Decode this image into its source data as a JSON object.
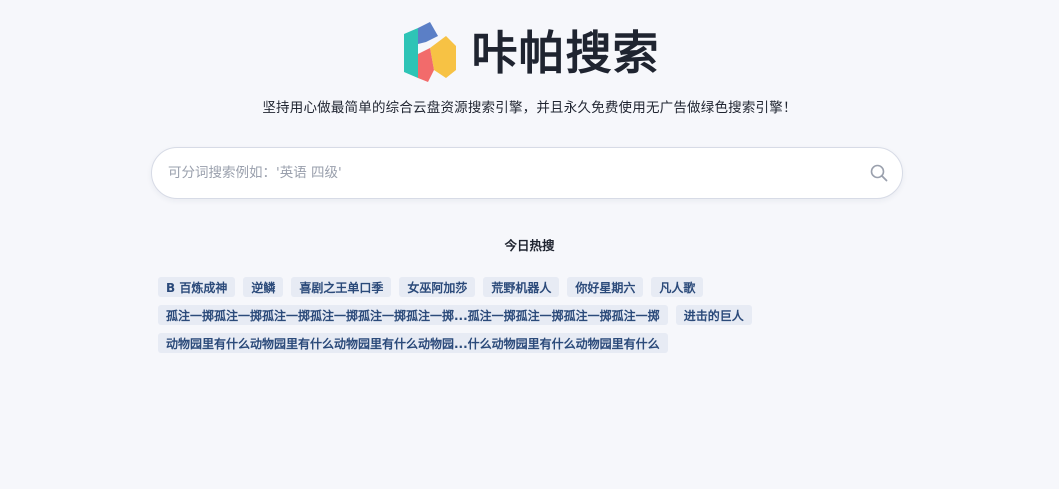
{
  "brand": {
    "title": "咔帕搜索",
    "logo_colors": {
      "teal": "#2ec4b6",
      "blue": "#5b7fc6",
      "red": "#f26b6b",
      "yellow": "#f7c244"
    }
  },
  "tagline": "坚持用心做最简单的综合云盘资源搜索引擎，并且永久免费使用无广告做绿色搜索引擎！",
  "search": {
    "value": "",
    "placeholder": "可分词搜索例如：'英语 四级'",
    "icon": "search-icon"
  },
  "hot": {
    "title": "今日热搜",
    "rows": [
      [
        "B 百炼成神",
        "逆鳞",
        "喜剧之王单口季",
        "女巫阿加莎",
        "荒野机器人",
        "你好星期六",
        "凡人歌"
      ],
      [
        "孤注一掷孤注一掷孤注一掷孤注一掷孤注一掷孤注一掷...孤注一掷孤注一掷孤注一掷孤注一掷",
        "进击的巨人"
      ],
      [
        "动物园里有什么动物园里有什么动物园里有什么动物园...什么动物园里有什么动物园里有什么"
      ]
    ]
  },
  "colors": {
    "background": "#f6f7fb",
    "tag_bg": "#e7ebf4",
    "tag_text": "#2b4a7a"
  }
}
